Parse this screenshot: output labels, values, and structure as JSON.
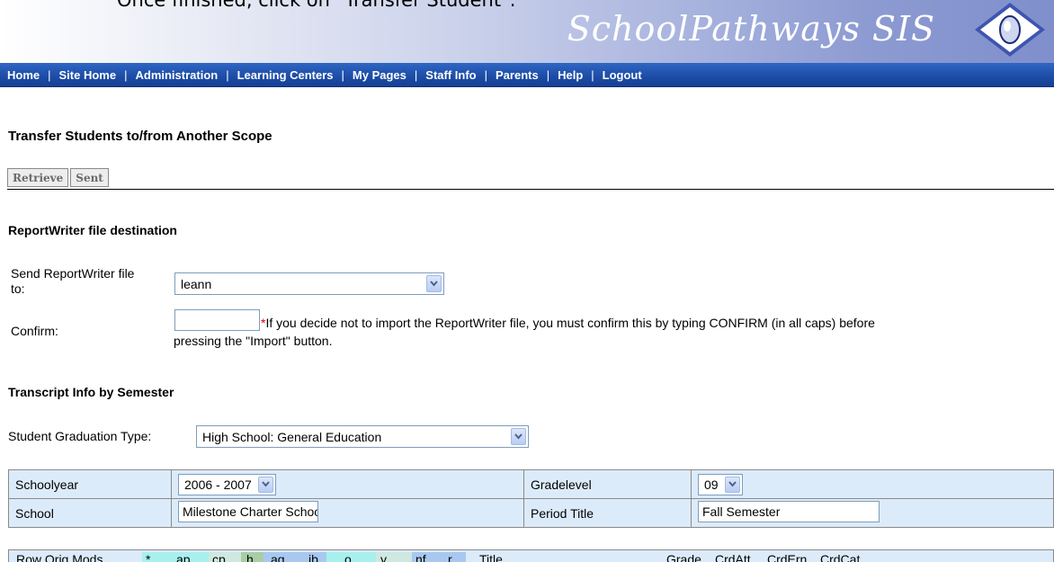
{
  "caption": "Once finished, click on \"Transfer Student\".",
  "brand": "SchoolPathways SIS",
  "nav": [
    "Home",
    "Site Home",
    "Administration",
    "Learning Centers",
    "My Pages",
    "Staff Info",
    "Parents",
    "Help",
    "Logout"
  ],
  "page_title": "Transfer Students to/from Another Scope",
  "tabs": [
    "Retrieve",
    "Sent"
  ],
  "rw_section": "ReportWriter file destination",
  "send_label_1": "Send ReportWriter file",
  "send_label_2": "to:",
  "send_value": "leann",
  "confirm_label": "Confirm:",
  "confirm_value": "",
  "note_required": "*",
  "note_line1": "If you decide not to import the ReportWriter file, you must confirm this by typing CONFIRM (in all caps) before",
  "note_line2": "pressing the \"Import\" button.",
  "transcript_section": "Transcript Info by Semester",
  "grad_type_label": "Student Graduation Type:",
  "grad_type_value": "High School: General Education",
  "table": {
    "schoolyear_label": "Schoolyear",
    "schoolyear_value": "2006 - 2007",
    "gradelevel_label": "Gradelevel",
    "gradelevel_value": "09",
    "school_label": "School",
    "school_value": "Milestone Charter Schoo",
    "period_label": "Period Title",
    "period_value": "Fall Semester"
  },
  "mods_row": {
    "label": "Row Orig Mods",
    "codes": [
      "*",
      "ap",
      "cp",
      "h",
      "ag",
      "ib",
      "o",
      "y",
      "nf",
      "r"
    ],
    "headers": [
      "Title",
      "Grade",
      "CrdAtt",
      "CrdErn",
      "CrdCat"
    ]
  },
  "icons": {
    "dropdown": "chevron-down-icon",
    "logo": "mouse-logo-icon"
  }
}
